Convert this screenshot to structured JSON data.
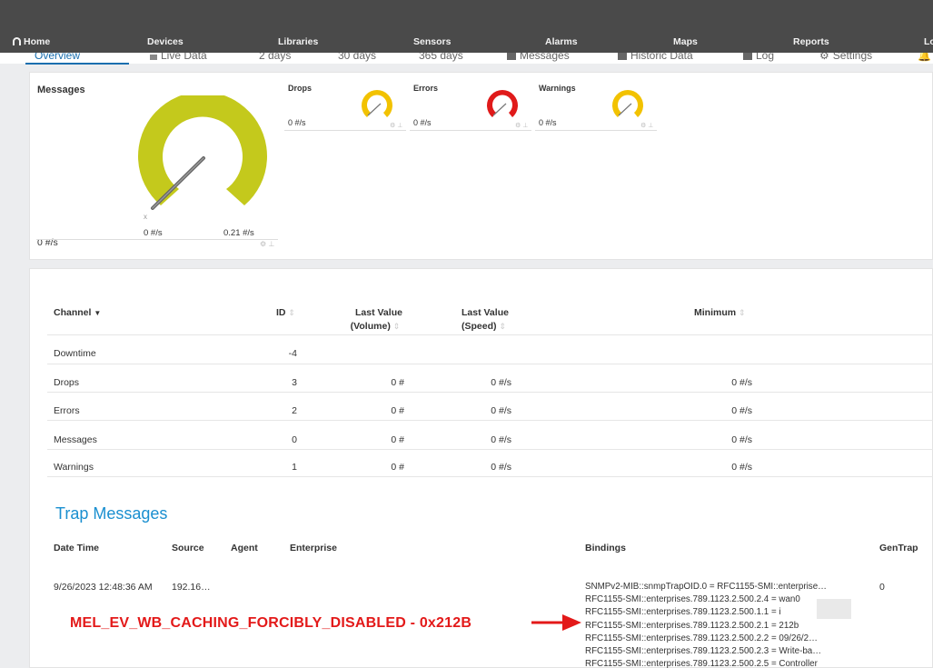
{
  "nav": {
    "items": [
      "Home",
      "Devices",
      "Libraries",
      "Sensors",
      "Alarms",
      "Maps",
      "Reports",
      "Lo"
    ]
  },
  "tabs": [
    "Overview",
    "Live Data",
    "2  days",
    "30 days",
    "365 days",
    "Messages",
    "Historic Data",
    "Log",
    "Settings"
  ],
  "gauges": {
    "main": {
      "label": "Messages",
      "value": "0 #/s",
      "min": "0 #/s",
      "max": "0.21 #/s",
      "color": "#c4c91c"
    },
    "small": [
      {
        "label": "Drops",
        "value": "0 #/s",
        "color": "#f2c200"
      },
      {
        "label": "Errors",
        "value": "0 #/s",
        "color": "#e01a1a"
      },
      {
        "label": "Warnings",
        "value": "0 #/s",
        "color": "#f2c200"
      }
    ]
  },
  "channel_table": {
    "headers": {
      "channel": "Channel",
      "id": "ID",
      "last_volume_1": "Last Value",
      "last_volume_2": "(Volume)",
      "last_speed_1": "Last Value",
      "last_speed_2": "(Speed)",
      "minimum": "Minimum"
    },
    "rows": [
      {
        "channel": "Downtime",
        "id": "-4",
        "volume": "",
        "speed": "",
        "minimum": ""
      },
      {
        "channel": "Drops",
        "id": "3",
        "volume": "0 #",
        "speed": "0 #/s",
        "minimum": "0 #/s"
      },
      {
        "channel": "Errors",
        "id": "2",
        "volume": "0 #",
        "speed": "0 #/s",
        "minimum": "0 #/s"
      },
      {
        "channel": "Messages",
        "id": "0",
        "volume": "0 #",
        "speed": "0 #/s",
        "minimum": "0 #/s"
      },
      {
        "channel": "Warnings",
        "id": "1",
        "volume": "0 #",
        "speed": "0 #/s",
        "minimum": "0 #/s"
      }
    ]
  },
  "trap": {
    "title": "Trap Messages",
    "headers": {
      "datetime": "Date Time",
      "source": "Source",
      "agent": "Agent",
      "enterprise": "Enterprise",
      "bindings": "Bindings",
      "gentrap": "GenTrap"
    },
    "row": {
      "datetime": "9/26/2023 12:48:36 AM",
      "source": "192.16…",
      "gentrap": "0",
      "bindings": [
        "SNMPv2-MIB::snmpTrapOID.0 = RFC1155-SMI::enterprise…",
        "RFC1155-SMI::enterprises.789.1123.2.500.2.4 = wan0",
        "RFC1155-SMI::enterprises.789.1123.2.500.1.1 = i",
        "RFC1155-SMI::enterprises.789.1123.2.500.2.1 = 212b",
        "RFC1155-SMI::enterprises.789.1123.2.500.2.2 = 09/26/2…",
        "RFC1155-SMI::enterprises.789.1123.2.500.2.3 = Write-ba…",
        "RFC1155-SMI::enterprises.789.1123.2.500.2.5 = Controller"
      ]
    }
  },
  "annotation": {
    "text": "MEL_EV_WB_CACHING_FORCIBLY_DISABLED - 0x212B",
    "color": "#e31919"
  }
}
